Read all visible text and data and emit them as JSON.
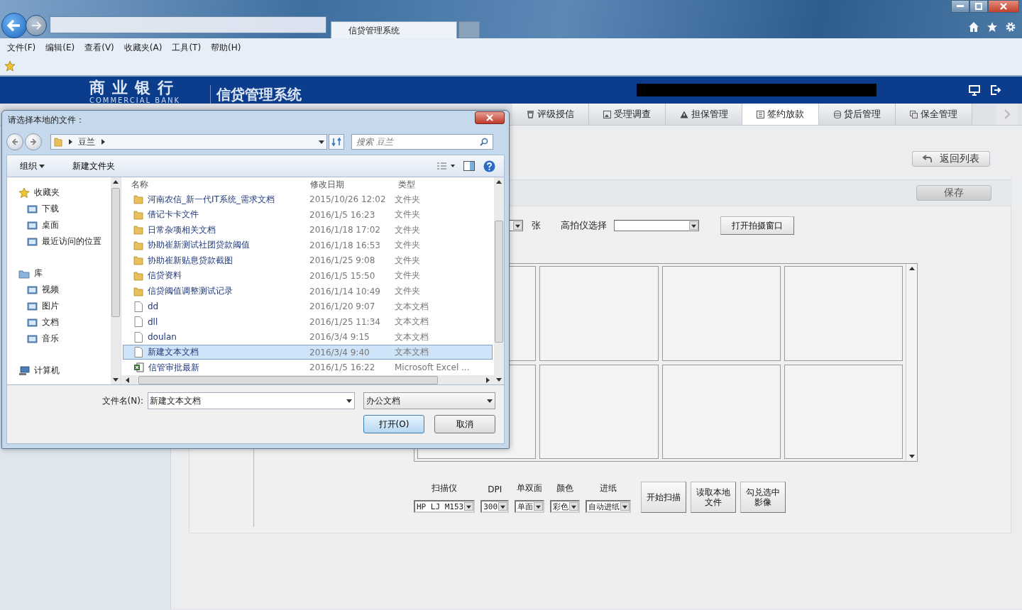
{
  "browser": {
    "tab_title": "信贷管理系统",
    "menu": [
      "文件(F)",
      "编辑(E)",
      "查看(V)",
      "收藏夹(A)",
      "工具(T)",
      "帮助(H)"
    ]
  },
  "header": {
    "bank_name": "商业银行",
    "bank_name_en": "COMMERCIAL BANK",
    "system_name": "信贷管理系统"
  },
  "module_tabs": [
    {
      "label": "评级授信",
      "selected": false
    },
    {
      "label": "受理调查",
      "selected": false
    },
    {
      "label": "担保管理",
      "selected": false
    },
    {
      "label": "签约放款",
      "selected": true
    },
    {
      "label": "贷后管理",
      "selected": false
    },
    {
      "label": "保全管理",
      "selected": false
    }
  ],
  "actions": {
    "back": "返回列表",
    "save": "保存"
  },
  "capture": {
    "unit": "张",
    "camera_label": "高拍仪选择",
    "open_button": "打开拍摄窗口"
  },
  "scanner": {
    "fields": [
      {
        "label": "扫描仪",
        "value": "HP LJ M153"
      },
      {
        "label": "DPI",
        "value": "300"
      },
      {
        "label": "单双面",
        "value": "单面"
      },
      {
        "label": "颜色",
        "value": "彩色"
      },
      {
        "label": "进纸",
        "value": "自动进纸"
      }
    ],
    "buttons": [
      "开始扫描",
      "读取本地文件",
      "勾兑选中影像"
    ]
  },
  "dialog": {
    "title": "请选择本地的文件：",
    "path": [
      "豆兰"
    ],
    "search_placeholder": "搜索 豆兰",
    "toolbar": [
      "组织",
      "新建文件夹"
    ],
    "nav": [
      {
        "label": "收藏夹",
        "children": [
          {
            "label": "下载"
          },
          {
            "label": "桌面"
          },
          {
            "label": "最近访问的位置"
          }
        ]
      },
      {
        "label": "库",
        "children": [
          {
            "label": "视频"
          },
          {
            "label": "图片"
          },
          {
            "label": "文档"
          },
          {
            "label": "音乐"
          }
        ]
      },
      {
        "label": "计算机"
      }
    ],
    "columns": [
      "名称",
      "修改日期",
      "类型"
    ],
    "files": [
      {
        "name": "河南农信_新一代IT系统_需求文档",
        "date": "2015/10/26 12:02",
        "type": "文件夹",
        "kind": "folder",
        "selected": false
      },
      {
        "name": "借记卡卡文件",
        "date": "2016/1/5 16:23",
        "type": "文件夹",
        "kind": "folder",
        "selected": false
      },
      {
        "name": "日常杂项相关文档",
        "date": "2016/1/18 17:02",
        "type": "文件夹",
        "kind": "folder",
        "selected": false
      },
      {
        "name": "协助崔新测试社团贷款阈值",
        "date": "2016/1/18 16:53",
        "type": "文件夹",
        "kind": "folder",
        "selected": false
      },
      {
        "name": "协助崔新贴息贷款截图",
        "date": "2016/1/25 9:08",
        "type": "文件夹",
        "kind": "folder",
        "selected": false
      },
      {
        "name": "信贷资料",
        "date": "2016/1/5 15:50",
        "type": "文件夹",
        "kind": "folder",
        "selected": false
      },
      {
        "name": "信贷阈值调整测试记录",
        "date": "2016/1/14 10:49",
        "type": "文件夹",
        "kind": "folder",
        "selected": false
      },
      {
        "name": "dd",
        "date": "2016/1/20 9:07",
        "type": "文本文档",
        "kind": "text",
        "selected": false
      },
      {
        "name": "dll",
        "date": "2016/1/25 11:34",
        "type": "文本文档",
        "kind": "text",
        "selected": false
      },
      {
        "name": "doulan",
        "date": "2016/3/4 9:15",
        "type": "文本文档",
        "kind": "text",
        "selected": false
      },
      {
        "name": "新建文本文档",
        "date": "2016/3/4 9:40",
        "type": "文本文档",
        "kind": "text",
        "selected": true
      },
      {
        "name": "信管审批最新",
        "date": "2016/1/5 16:22",
        "type": "Microsoft Excel ...",
        "kind": "excel",
        "selected": false
      }
    ],
    "filename_label": "文件名(N):",
    "filename": "新建文本文档",
    "filetype": "办公文档",
    "buttons": [
      "打开(O)",
      "取消"
    ]
  }
}
